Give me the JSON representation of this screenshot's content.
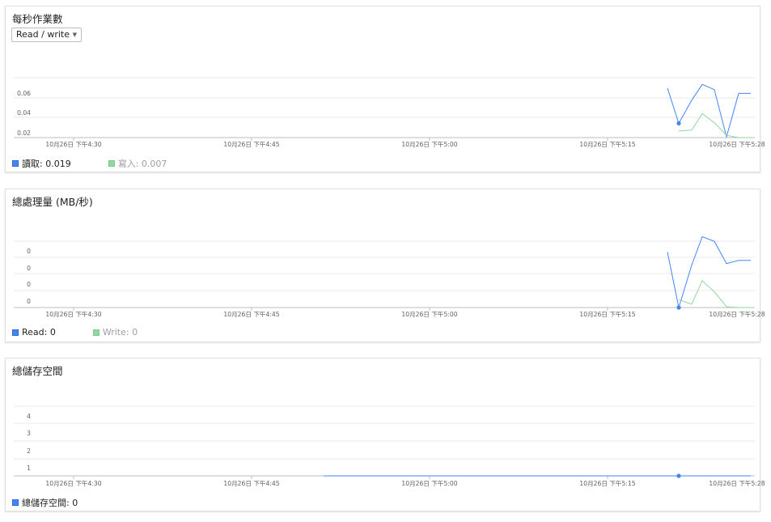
{
  "colors": {
    "read": "#4285f4",
    "write": "#93d69f",
    "grid": "#e8e8e8",
    "axis": "#bdbdbd"
  },
  "x_tick_labels": [
    "10月26日 下午4:30",
    "10月26日 下午4:45",
    "10月26日 下午5:00",
    "10月26日 下午5:15",
    "10月26日 下午5:28"
  ],
  "ops_card": {
    "title": "每秒作業數",
    "dropdown_label": "Read / write",
    "legend": [
      {
        "label": "讀取: 0.019"
      },
      {
        "label": "寫入: 0.007"
      }
    ]
  },
  "throughput_card": {
    "title": "總處理量 (MB/秒)",
    "legend": [
      {
        "label": "Read: 0"
      },
      {
        "label": "Write: 0"
      }
    ]
  },
  "storage_card": {
    "title": "總儲存空間",
    "legend": [
      {
        "label": "總儲存空間: 0"
      }
    ]
  },
  "chart_data": [
    {
      "type": "line",
      "title": "每秒作業數",
      "x": [
        "16:30",
        "16:45",
        "17:00",
        "17:15",
        "17:28"
      ],
      "y_ticks": [
        "0.02",
        "0.04",
        "0.06"
      ],
      "ylim": [
        0,
        0.08
      ],
      "series": [
        {
          "name": "讀取",
          "points": [
            [
              1048,
              0.066
            ],
            [
              1050,
              0.019
            ],
            [
              1052,
              0.05
            ],
            [
              1054,
              0.071
            ],
            [
              1056,
              0.064
            ],
            [
              1058,
              0.001
            ],
            [
              1059,
              0.059
            ],
            [
              1061,
              0.059
            ]
          ]
        },
        {
          "name": "寫入",
          "points": [
            [
              1050,
              0.009
            ],
            [
              1052,
              0.01
            ],
            [
              1054,
              0.032
            ],
            [
              1056,
              0.02
            ],
            [
              1058,
              0.003
            ],
            [
              1059,
              0.0
            ],
            [
              1061,
              0.0
            ]
          ]
        }
      ],
      "hover_point": {
        "series": 0,
        "x": 1050,
        "y": 0.019
      }
    },
    {
      "type": "line",
      "title": "總處理量 (MB/秒)",
      "x": [
        "16:30",
        "16:45",
        "17:00",
        "17:15",
        "17:28"
      ],
      "y_ticks": [
        "0",
        "0",
        "0",
        "0"
      ],
      "ylim": [
        0,
        0.004
      ],
      "series": [
        {
          "name": "Read",
          "points": [
            [
              1048,
              0.00334
            ],
            [
              1050,
              0.0
            ],
            [
              1052,
              0.00256
            ],
            [
              1054,
              0.00427
            ],
            [
              1056,
              0.00399
            ],
            [
              1058,
              0.00265
            ],
            [
              1059,
              0.00284
            ],
            [
              1061,
              0.00284
            ]
          ]
        },
        {
          "name": "Write",
          "points": [
            [
              1050,
              0.00047
            ],
            [
              1052,
              0.0002
            ],
            [
              1054,
              0.00162
            ],
            [
              1056,
              0.00095
            ],
            [
              1058,
              5e-05
            ],
            [
              1059,
              0.0
            ],
            [
              1061,
              0.0
            ]
          ]
        }
      ],
      "hover_point": {
        "series": 0,
        "x": 1050,
        "y": 0.0
      }
    },
    {
      "type": "line",
      "title": "總儲存空間",
      "x": [
        "16:30",
        "16:45",
        "17:00",
        "17:15",
        "17:28"
      ],
      "y_ticks": [
        "1",
        "2",
        "3",
        "4"
      ],
      "ylim": [
        0,
        4.5
      ],
      "series": [
        {
          "name": "總儲存空間",
          "points": [
            [
              1007,
              0
            ],
            [
              1061,
              0
            ]
          ]
        }
      ],
      "hover_point": {
        "series": 0,
        "x": 1050,
        "y": 0
      }
    }
  ]
}
